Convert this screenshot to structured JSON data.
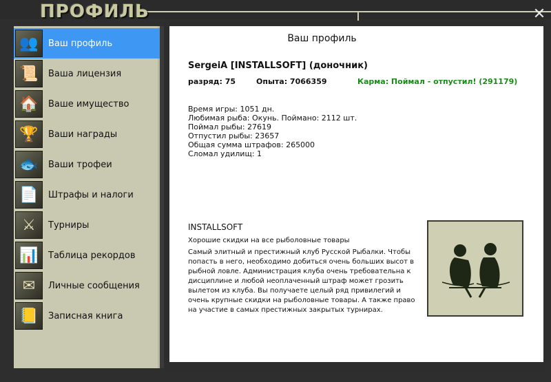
{
  "window": {
    "title": "ПРОФИЛЬ",
    "close_glyph": "✕"
  },
  "sidebar": {
    "items": [
      {
        "label": "Ваш профиль",
        "icon": "users-icon",
        "glyph": "👥",
        "active": true
      },
      {
        "label": "Ваша лицензия",
        "icon": "license-icon",
        "glyph": "📜",
        "active": false
      },
      {
        "label": "Ваше имущество",
        "icon": "house-icon",
        "glyph": "🏠",
        "active": false
      },
      {
        "label": "Ваши награды",
        "icon": "trophy-icon",
        "glyph": "🏆",
        "active": false
      },
      {
        "label": "Ваши трофеи",
        "icon": "fish-icon",
        "glyph": "🐟",
        "active": false
      },
      {
        "label": "Штрафы и налоги",
        "icon": "document-icon",
        "glyph": "📄",
        "active": false
      },
      {
        "label": "Турниры",
        "icon": "tournament-icon",
        "glyph": "⚔",
        "active": false
      },
      {
        "label": "Таблица рекордов",
        "icon": "bar-chart-icon",
        "glyph": "📊",
        "active": false
      },
      {
        "label": "Личные сообщения",
        "icon": "envelope-icon",
        "glyph": "✉",
        "active": false
      },
      {
        "label": "Записная книга",
        "icon": "notebook-icon",
        "glyph": "📒",
        "active": false
      }
    ]
  },
  "profile": {
    "heading": "Ваш профиль",
    "user_name": "SergeiA [INSTALLSOFT] (доночник)",
    "rank": "разряд: 75",
    "experience": "Опыта: 7066359",
    "karma": "Карма: Поймал - отпустил! (291179)",
    "stats": [
      "Время игры: 1051 дн.",
      "Любимая рыба: Окунь. Поймано: 2112 шт.",
      "Поймал рыбы: 27619",
      "Отпустил рыбы: 23657",
      "Общая сумма штрафов: 265000",
      "Сломал удилищ: 1"
    ]
  },
  "club": {
    "name": "INSTALLSOFT",
    "subtitle": "Хорошие скидки на все рыболовные товары",
    "description": "Самый элитный и престижный клуб Русской Рыбалки. Чтобы попасть в него, необходимо добиться очень больших высот в рыбной ловле. Администрация клуба очень требовательна к дисциплине и любой неоплаченный штраф может грозить вылетом из клуба. Вы получаете целый ряд привилегий и очень крупные скидки на рыболовные товары. А также право на участие в самых престижных закрытых турнирах.",
    "logo_icon": "club-emblem-icon"
  }
}
